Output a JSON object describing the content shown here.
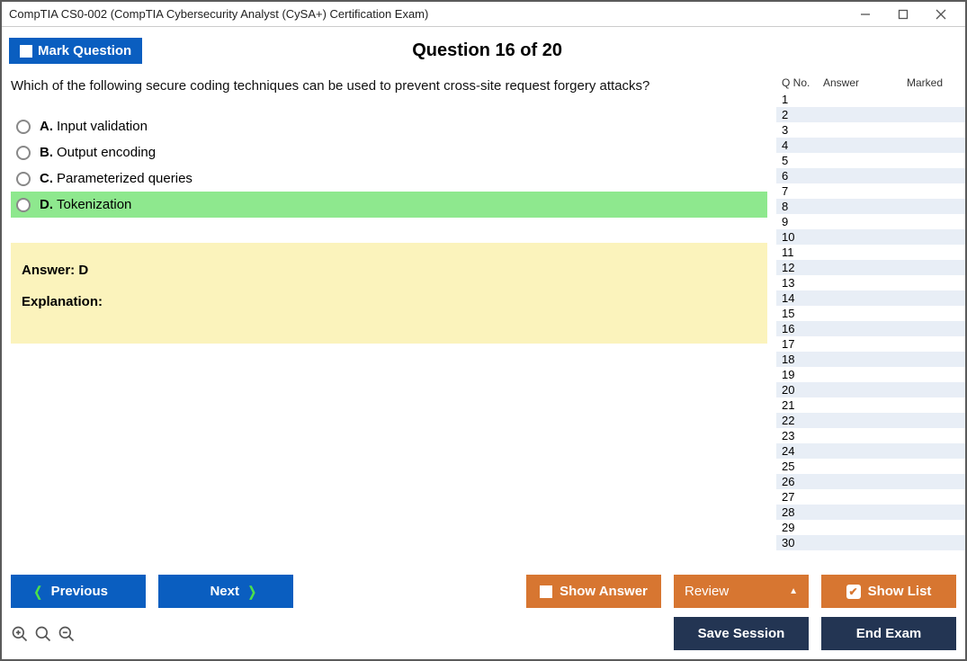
{
  "window": {
    "title": "CompTIA CS0-002 (CompTIA Cybersecurity Analyst (CySA+) Certification Exam)"
  },
  "header": {
    "mark_label": "Mark Question",
    "question_heading": "Question 16 of 20"
  },
  "question": {
    "text": "Which of the following secure coding techniques can be used to prevent cross-site request forgery attacks?",
    "options": [
      {
        "letter": "A.",
        "text": "Input validation",
        "correct": false
      },
      {
        "letter": "B.",
        "text": "Output encoding",
        "correct": false
      },
      {
        "letter": "C.",
        "text": "Parameterized queries",
        "correct": false
      },
      {
        "letter": "D.",
        "text": "Tokenization",
        "correct": true
      }
    ],
    "answer_label": "Answer: D",
    "explanation_label": "Explanation:"
  },
  "qlist": {
    "headers": {
      "qno": "Q No.",
      "answer": "Answer",
      "marked": "Marked"
    },
    "rows": [
      {
        "n": "1"
      },
      {
        "n": "2"
      },
      {
        "n": "3"
      },
      {
        "n": "4"
      },
      {
        "n": "5"
      },
      {
        "n": "6"
      },
      {
        "n": "7"
      },
      {
        "n": "8"
      },
      {
        "n": "9"
      },
      {
        "n": "10"
      },
      {
        "n": "11"
      },
      {
        "n": "12"
      },
      {
        "n": "13"
      },
      {
        "n": "14"
      },
      {
        "n": "15"
      },
      {
        "n": "16"
      },
      {
        "n": "17"
      },
      {
        "n": "18"
      },
      {
        "n": "19"
      },
      {
        "n": "20"
      },
      {
        "n": "21"
      },
      {
        "n": "22"
      },
      {
        "n": "23"
      },
      {
        "n": "24"
      },
      {
        "n": "25"
      },
      {
        "n": "26"
      },
      {
        "n": "27"
      },
      {
        "n": "28"
      },
      {
        "n": "29"
      },
      {
        "n": "30"
      }
    ]
  },
  "footer": {
    "previous": "Previous",
    "next": "Next",
    "show_answer": "Show Answer",
    "review": "Review",
    "show_list": "Show List",
    "save_session": "Save Session",
    "end_exam": "End Exam"
  }
}
